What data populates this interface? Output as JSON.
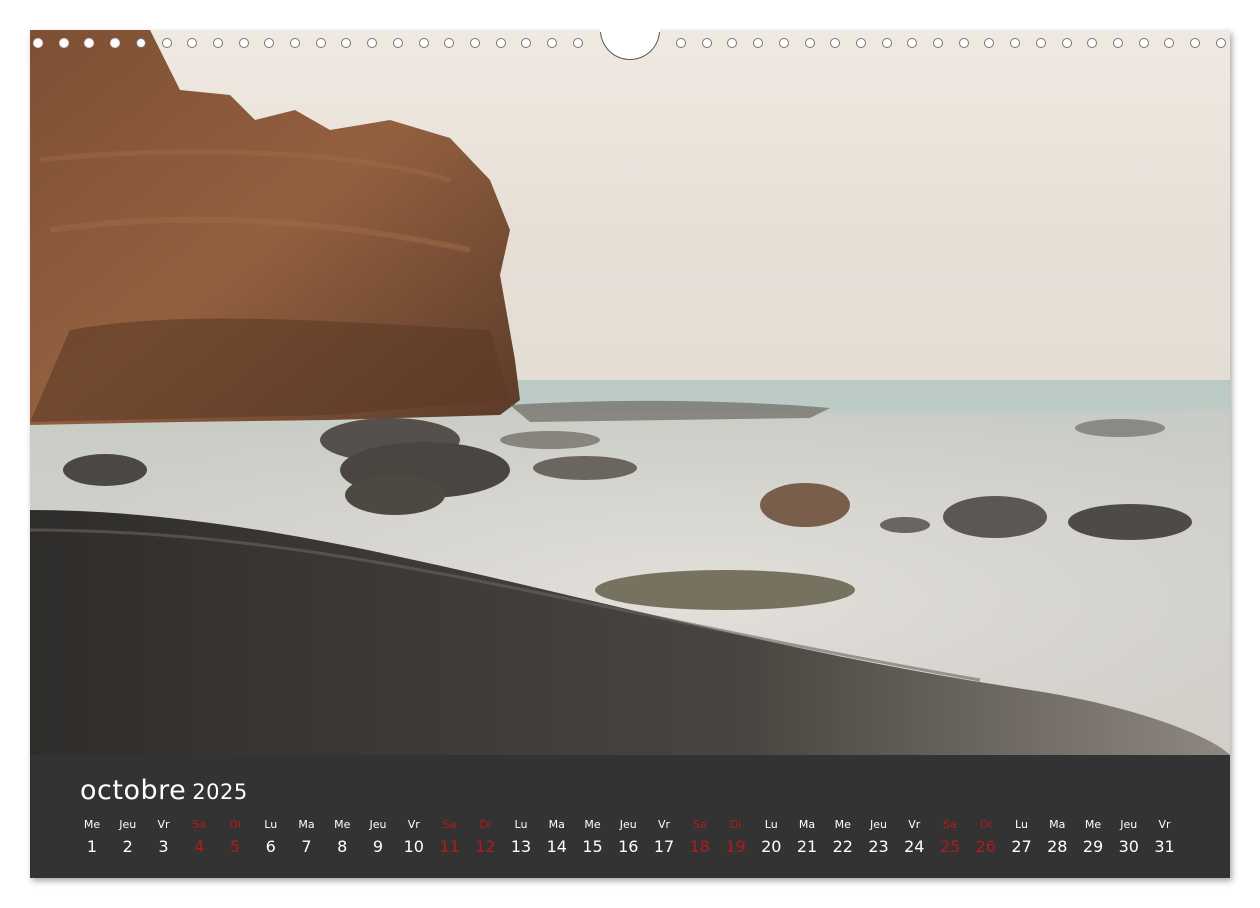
{
  "calendar": {
    "month": "octobre",
    "year": "2025",
    "colors": {
      "band": "#333333",
      "text": "#ffffff",
      "weekend": "#b01c1c"
    },
    "days": [
      {
        "dow": "Me",
        "num": "1",
        "weekend": false
      },
      {
        "dow": "Jeu",
        "num": "2",
        "weekend": false
      },
      {
        "dow": "Vr",
        "num": "3",
        "weekend": false
      },
      {
        "dow": "Sa",
        "num": "4",
        "weekend": true
      },
      {
        "dow": "Di",
        "num": "5",
        "weekend": true
      },
      {
        "dow": "Lu",
        "num": "6",
        "weekend": false
      },
      {
        "dow": "Ma",
        "num": "7",
        "weekend": false
      },
      {
        "dow": "Me",
        "num": "8",
        "weekend": false
      },
      {
        "dow": "Jeu",
        "num": "9",
        "weekend": false
      },
      {
        "dow": "Vr",
        "num": "10",
        "weekend": false
      },
      {
        "dow": "Sa",
        "num": "11",
        "weekend": true
      },
      {
        "dow": "Di",
        "num": "12",
        "weekend": true
      },
      {
        "dow": "Lu",
        "num": "13",
        "weekend": false
      },
      {
        "dow": "Ma",
        "num": "14",
        "weekend": false
      },
      {
        "dow": "Me",
        "num": "15",
        "weekend": false
      },
      {
        "dow": "Jeu",
        "num": "16",
        "weekend": false
      },
      {
        "dow": "Vr",
        "num": "17",
        "weekend": false
      },
      {
        "dow": "Sa",
        "num": "18",
        "weekend": true
      },
      {
        "dow": "Di",
        "num": "19",
        "weekend": true
      },
      {
        "dow": "Lu",
        "num": "20",
        "weekend": false
      },
      {
        "dow": "Ma",
        "num": "21",
        "weekend": false
      },
      {
        "dow": "Me",
        "num": "22",
        "weekend": false
      },
      {
        "dow": "Jeu",
        "num": "23",
        "weekend": false
      },
      {
        "dow": "Vr",
        "num": "24",
        "weekend": false
      },
      {
        "dow": "Sa",
        "num": "25",
        "weekend": true
      },
      {
        "dow": "Di",
        "num": "26",
        "weekend": true
      },
      {
        "dow": "Lu",
        "num": "27",
        "weekend": false
      },
      {
        "dow": "Ma",
        "num": "28",
        "weekend": false
      },
      {
        "dow": "Me",
        "num": "29",
        "weekend": false
      },
      {
        "dow": "Jeu",
        "num": "30",
        "weekend": false
      },
      {
        "dow": "Vr",
        "num": "31",
        "weekend": false
      }
    ]
  },
  "photo": {
    "subject": "coastal-cliff-misty-sea",
    "colors": {
      "sky": "#e9e2d8",
      "cliff": "#8a5a3c",
      "sea": "#cfd8d3",
      "mist": "#d9d6d1",
      "beach": "#3d3a37"
    }
  },
  "binding": {
    "hanger_icon": "calendar-hanger-icon",
    "ring_icon": "binding-ring-icon"
  }
}
